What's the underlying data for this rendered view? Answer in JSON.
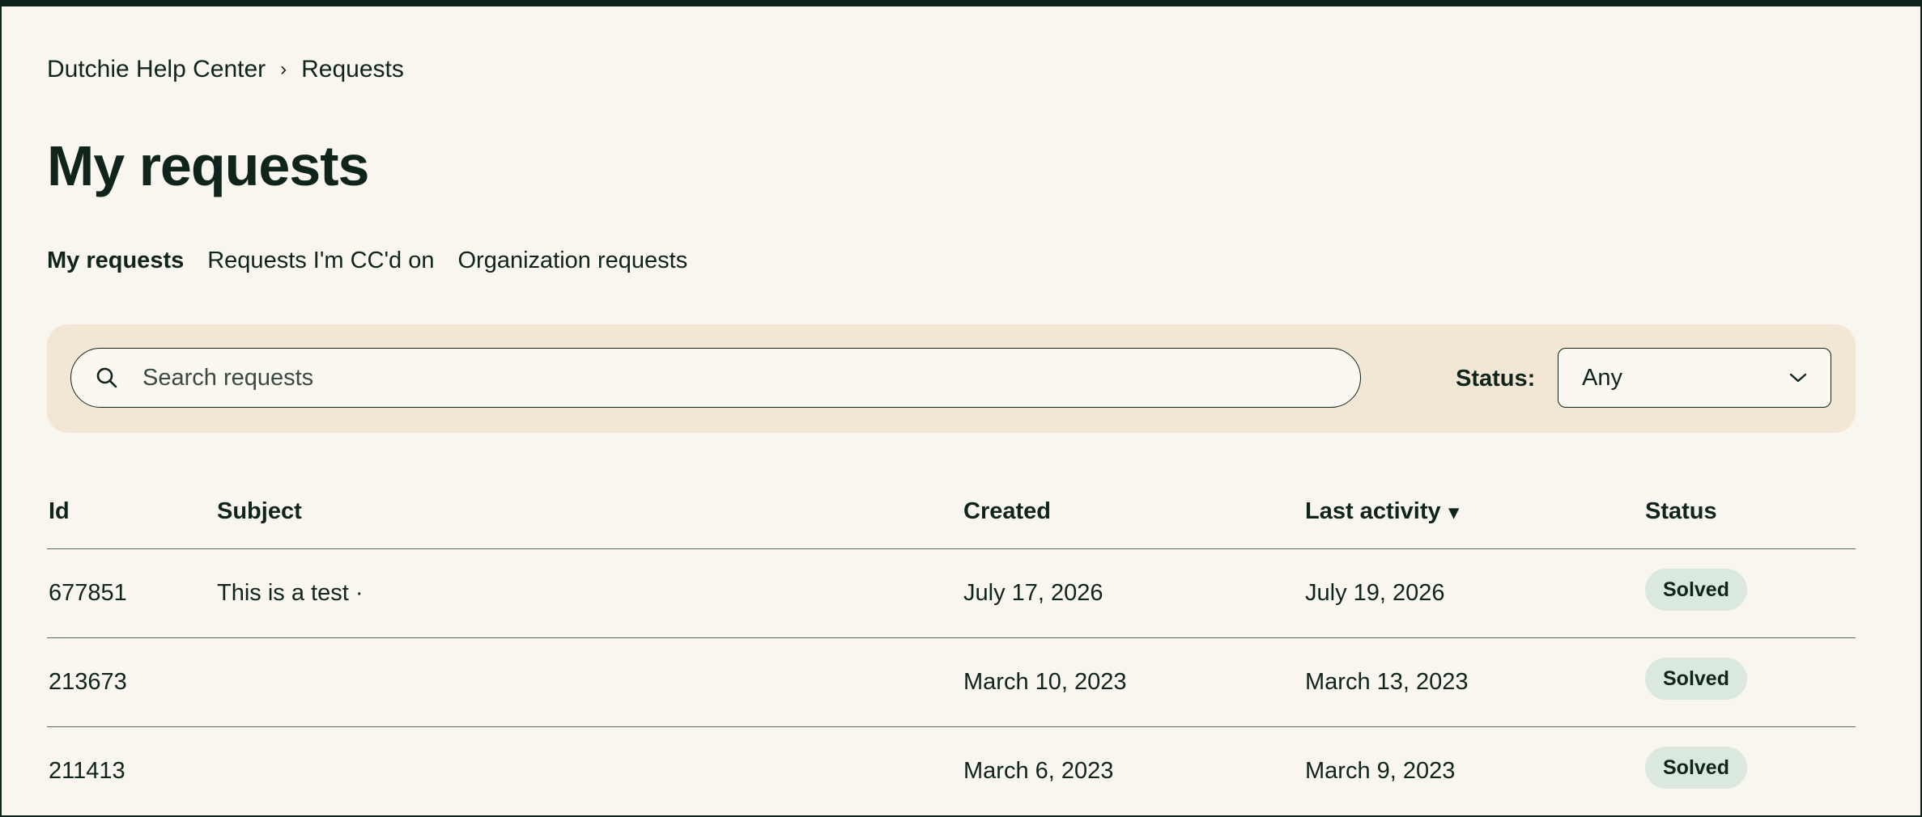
{
  "breadcrumb": {
    "home": "Dutchie Help Center",
    "separator": "›",
    "current": "Requests"
  },
  "page": {
    "title": "My requests"
  },
  "tabs": [
    {
      "label": "My requests",
      "active": true
    },
    {
      "label": "Requests I'm CC'd on",
      "active": false
    },
    {
      "label": "Organization requests",
      "active": false
    }
  ],
  "filters": {
    "search_placeholder": "Search requests",
    "search_icon": "search-icon",
    "status_label": "Status:",
    "status_value": "Any",
    "status_icon": "chevron-down-icon"
  },
  "table": {
    "headers": {
      "id": "Id",
      "subject": "Subject",
      "created": "Created",
      "last_activity": "Last activity",
      "sort_indicator": "▾",
      "status": "Status"
    },
    "rows": [
      {
        "id": "677851",
        "subject": "This is a test ·",
        "created": "July 17, 2026",
        "last_activity": "July 19, 2026",
        "status": "Solved"
      },
      {
        "id": "213673",
        "subject": "",
        "created": "March 10, 2023",
        "last_activity": "March 13, 2023",
        "status": "Solved"
      },
      {
        "id": "211413",
        "subject": "",
        "created": "March 6, 2023",
        "last_activity": "March 9, 2023",
        "status": "Solved"
      }
    ]
  },
  "colors": {
    "background": "#f9f6ef",
    "text": "#0f241a",
    "filter_panel": "#f1e7d4",
    "badge": "#dbe8dd"
  }
}
